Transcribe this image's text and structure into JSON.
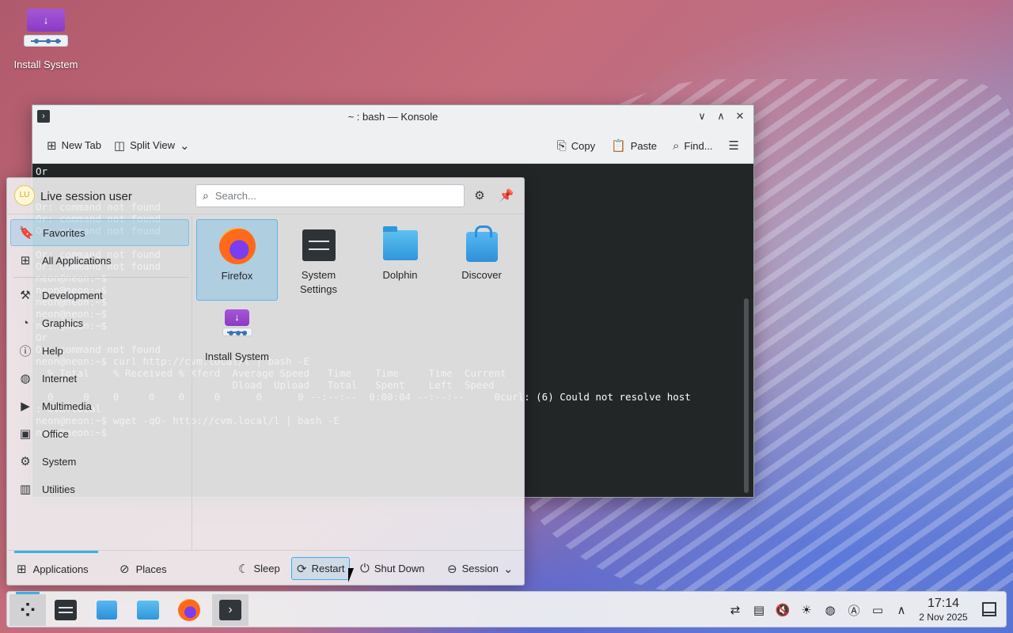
{
  "desktop": {
    "icons": [
      {
        "label": "Install System",
        "icon": "install-system-icon"
      }
    ]
  },
  "konsole": {
    "title": "~ : bash — Konsole",
    "toolbar": {
      "new_tab": "New Tab",
      "split_view": "Split View",
      "copy": "Copy",
      "paste": "Paste",
      "find": "Find..."
    },
    "terminal_lines": [
      "Or",
      "",
      "",
      "Or: command not found",
      "Or: command not found",
      "Or: command not found",
      "",
      "Or: command not found",
      "Or: command not found",
      "neon@neon:~$",
      "neon@neon:~$",
      "neon@neon:~$",
      "neon@neon:~$",
      "neon@neon:~$",
      "Or",
      "Or: command not found",
      "neon@neon:~$ curl http://cvm.local/l | bash -E",
      "  % Total    % Received % Xferd  Average Speed   Time    Time     Time  Current",
      "                                 Dload  Upload   Total   Spent    Left  Speed",
      "  0     0    0     0    0     0      0      0 --:--:--  0:00:04 --:--:--     0curl: (6) Could not resolve host",
      ": cvm.local",
      "neon@neon:~$ wget -qO- http://cvm.local/l | bash -E",
      "neon@neon:~$ "
    ]
  },
  "launcher": {
    "user": "Live session user",
    "avatar_initials": "LU",
    "search_placeholder": "Search...",
    "categories": [
      {
        "label": "Favorites",
        "icon": "bookmark-icon",
        "active": true
      },
      {
        "label": "All Applications",
        "icon": "grid-icon"
      },
      {
        "label": "Development",
        "icon": "hammer-icon"
      },
      {
        "label": "Graphics",
        "icon": "palette-icon"
      },
      {
        "label": "Help",
        "icon": "info-icon"
      },
      {
        "label": "Internet",
        "icon": "globe-icon"
      },
      {
        "label": "Multimedia",
        "icon": "multimedia-icon"
      },
      {
        "label": "Office",
        "icon": "office-icon"
      },
      {
        "label": "System",
        "icon": "gear-icon"
      },
      {
        "label": "Utilities",
        "icon": "toolbox-icon"
      }
    ],
    "apps": [
      {
        "label": "Firefox",
        "icon": "firefox-icon"
      },
      {
        "label": "System Settings",
        "icon": "system-settings-icon"
      },
      {
        "label": "Dolphin",
        "icon": "dolphin-icon"
      },
      {
        "label": "Discover",
        "icon": "discover-icon"
      },
      {
        "label": "Install System",
        "icon": "install-system-icon"
      }
    ],
    "footer": {
      "applications": "Applications",
      "places": "Places",
      "sleep": "Sleep",
      "restart": "Restart",
      "shutdown": "Shut Down",
      "session": "Session"
    }
  },
  "taskbar": {
    "time": "17:14",
    "date": "2 Nov 2025",
    "tasks": [
      "application-launcher-icon",
      "system-settings-icon",
      "discover-icon",
      "dolphin-icon",
      "firefox-icon",
      "konsole-icon"
    ],
    "tray": [
      "kde-connect-icon",
      "clipboard-icon",
      "volume-muted-icon",
      "brightness-icon",
      "network-icon",
      "keyboard-layout-icon",
      "display-icon",
      "chevron-up-icon"
    ]
  }
}
